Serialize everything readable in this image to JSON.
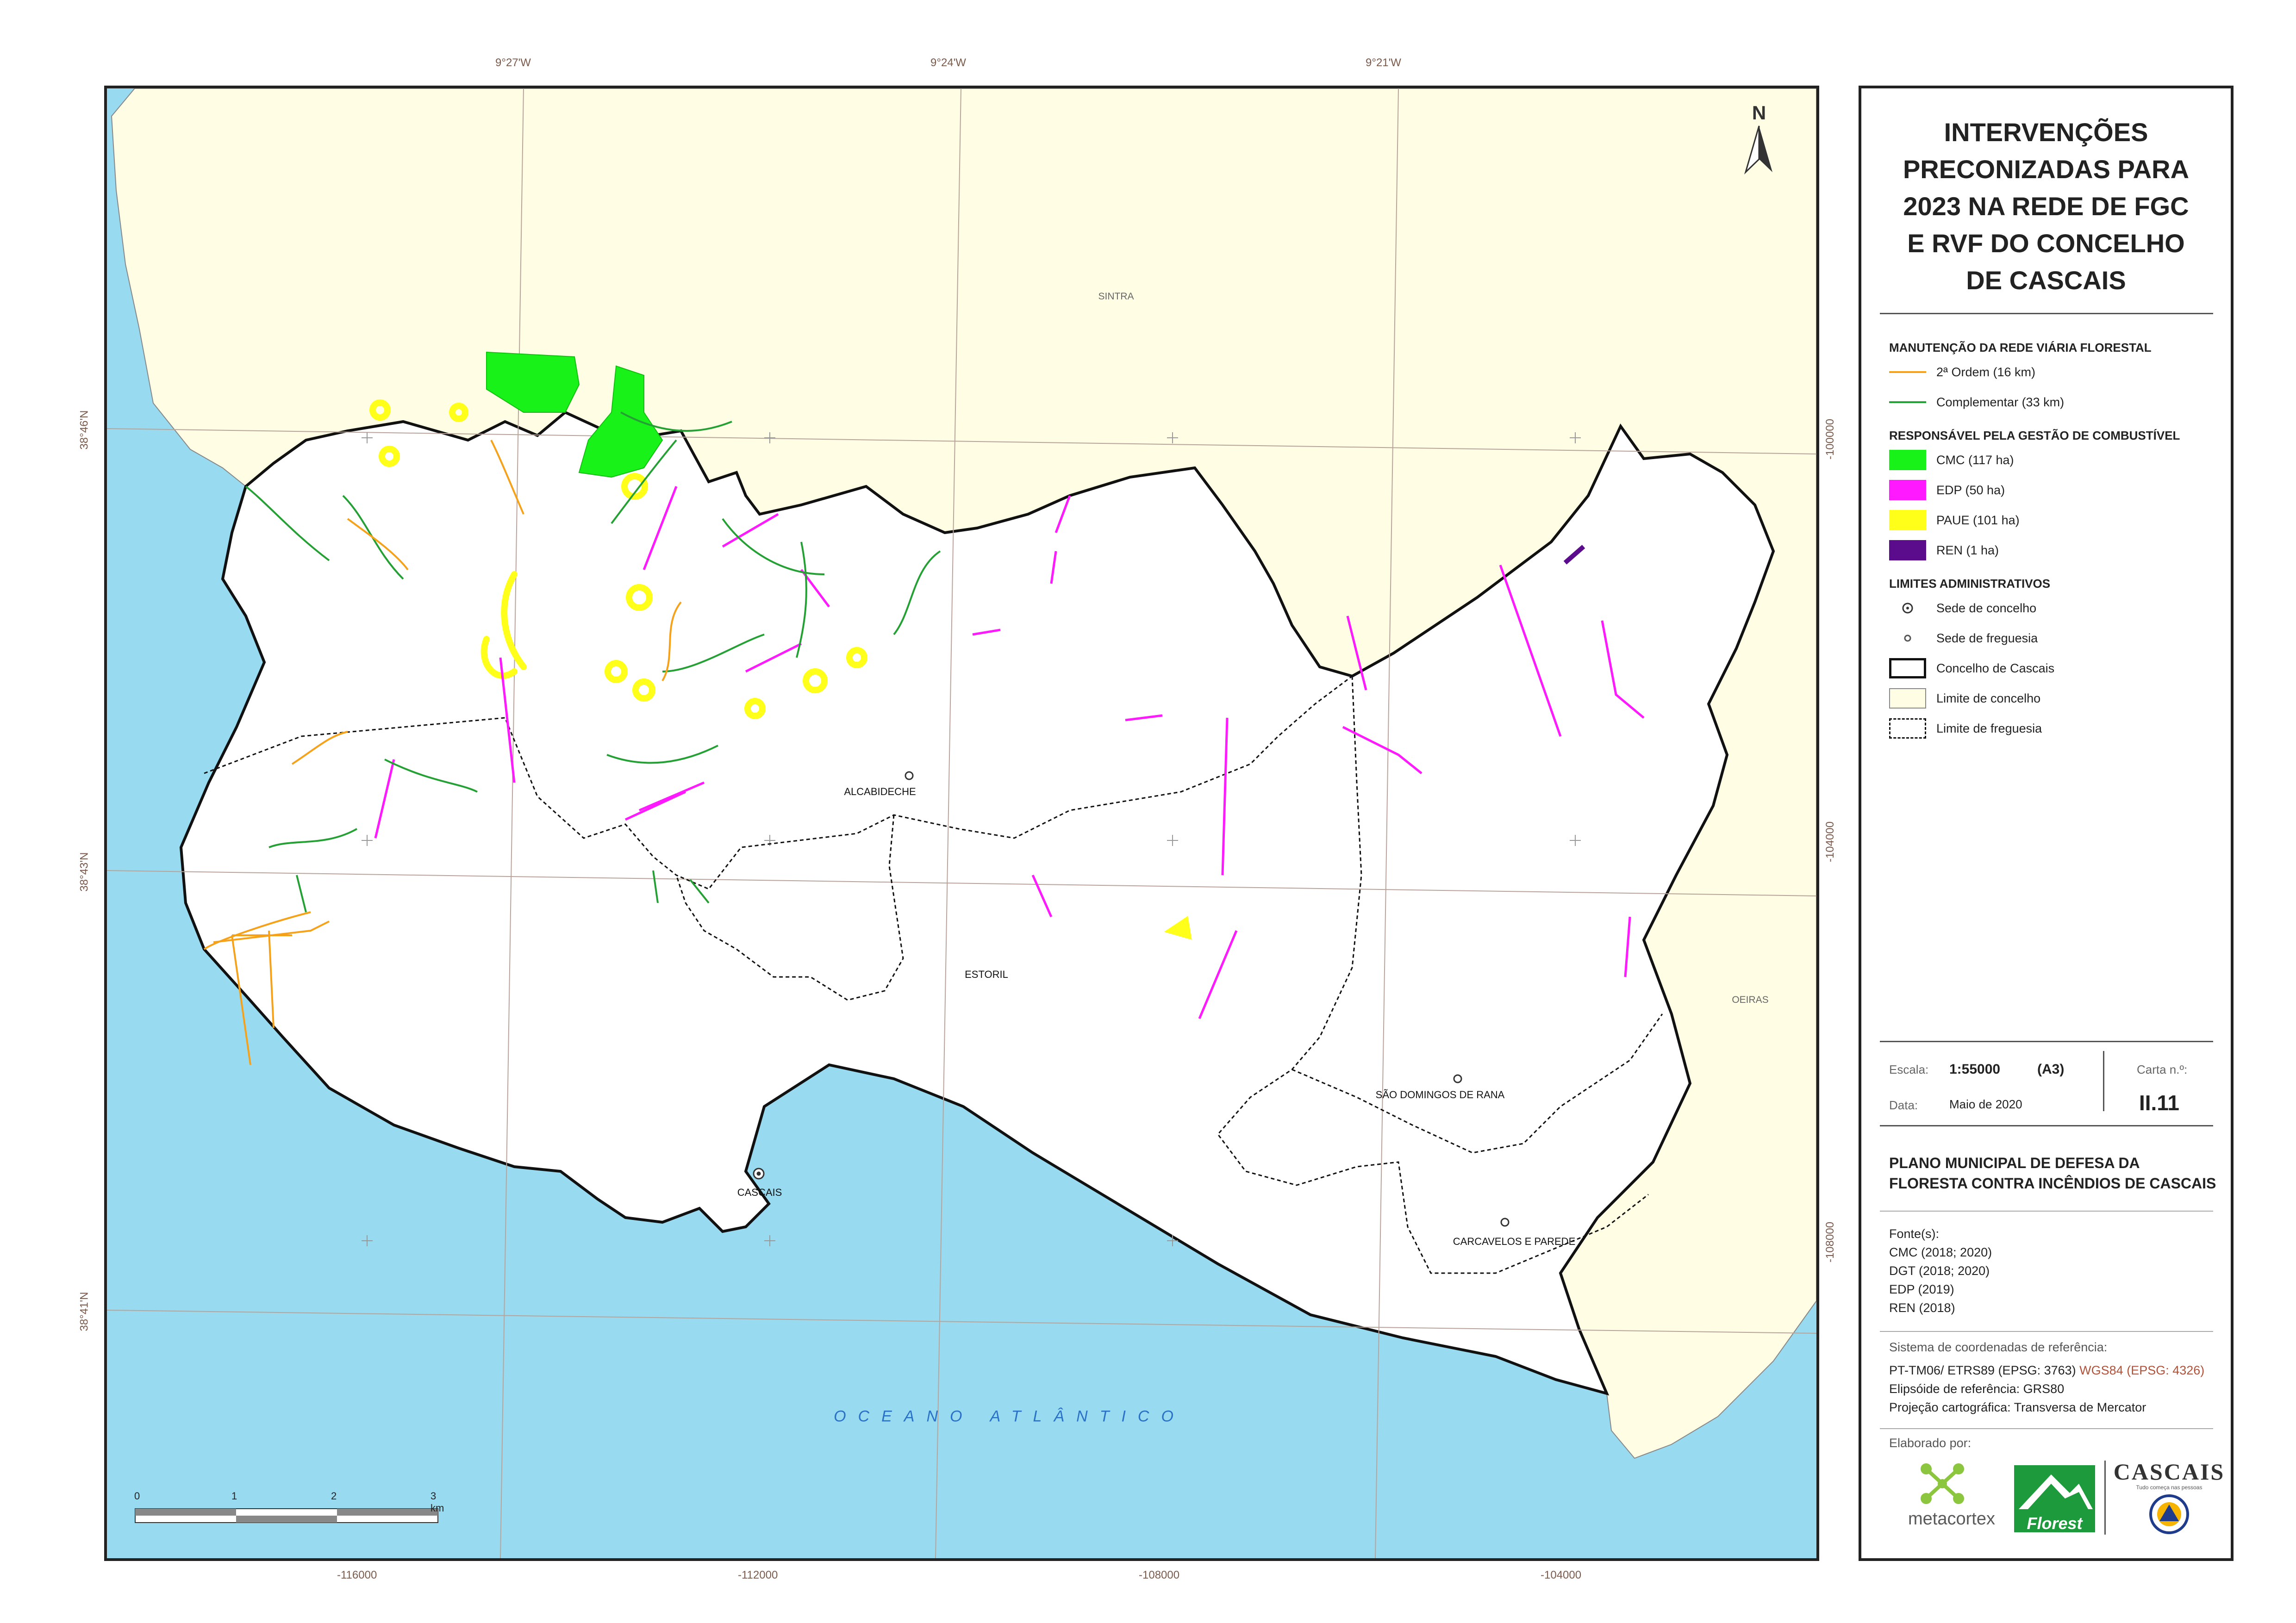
{
  "map": {
    "title": "INTERVENÇÕES\nPRECONIZADAS PARA\n2023 NA REDE DE FGC\nE RVF DO CONCELHO\nDE CASCAIS",
    "north_label": "N",
    "longitude_labels": [
      "9°27'W",
      "9°24'W",
      "9°21'W"
    ],
    "latitude_labels": [
      "38°46'N",
      "38°43'N",
      "38°41'N"
    ],
    "easting_labels": [
      "-116000",
      "-112000",
      "-108000",
      "-104000"
    ],
    "northing_labels": [
      "-100000",
      "-104000",
      "-108000"
    ],
    "place_labels": {
      "sintra": "SINTRA",
      "oeiras": "OEIRAS",
      "alcabideche": "ALCABIDECHE",
      "estoril": "ESTORIL",
      "sao_domingos": "SÃO DOMINGOS DE RANA",
      "cascais": "CASCAIS",
      "carcavelos": "CARCAVELOS E PAREDE"
    },
    "ocean_label": "OCEANO ATLÂNTICO",
    "scale_ticks": [
      "0",
      "1",
      "2",
      "3 km"
    ],
    "colors": {
      "sea": "#98daf0",
      "neighbour_land": "#fffde3",
      "municipality": "#ffffff",
      "road_2nd_order": "#f5a21a",
      "road_complementary": "#25a034",
      "cmc": "#19f219",
      "edp": "#ff19ff",
      "paue": "#ffff19",
      "ren": "#5a0c8c"
    }
  },
  "legend": {
    "road_heading": "MANUTENÇÃO DA REDE VIÁRIA FLORESTAL",
    "road_items": [
      "2ª Ordem (16 km)",
      "Complementar (33 km)"
    ],
    "fuel_heading": "RESPONSÁVEL PELA GESTÃO DE COMBUSTÍVEL",
    "fuel_items": [
      "CMC (117 ha)",
      "EDP (50 ha)",
      "PAUE (101 ha)",
      "REN (1 ha)"
    ],
    "admin_heading": "LIMITES ADMINISTRATIVOS",
    "admin_items": [
      "Sede de concelho",
      "Sede de freguesia",
      "Concelho de Cascais",
      "Limite de concelho",
      "Limite de freguesia"
    ]
  },
  "meta": {
    "scale_label": "Escala:",
    "scale_value": "1:55000",
    "paper": "(A3)",
    "sheet_label": "Carta n.º:",
    "sheet_value": "II.11",
    "date_label": "Data:",
    "date_value": "Maio de 2020"
  },
  "plan_title": "PLANO MUNICIPAL DE DEFESA DA\nFLORESTA CONTRA INCÊNDIOS DE CASCAIS",
  "sources": {
    "heading": "Fonte(s):",
    "items": [
      "CMC (2018; 2020)",
      "DGT (2018; 2020)",
      "EDP (2019)",
      "REN (2018)"
    ]
  },
  "crs": {
    "heading": "Sistema de coordenadas de referência:",
    "line1a": "PT-TM06/ ETRS89 (EPSG: 3763)",
    "line1b": "WGS84 (EPSG: 4326)",
    "line2": "Elipsóide de referência: GRS80",
    "line3": "Projeção cartográfica: Transversa de Mercator"
  },
  "credits": {
    "heading": "Elaborado por:",
    "metacortex": "metacortex",
    "florest": "Florest",
    "cascais": "CASCAIS",
    "cascais_tagline": "Tudo começa nas pessoas"
  }
}
